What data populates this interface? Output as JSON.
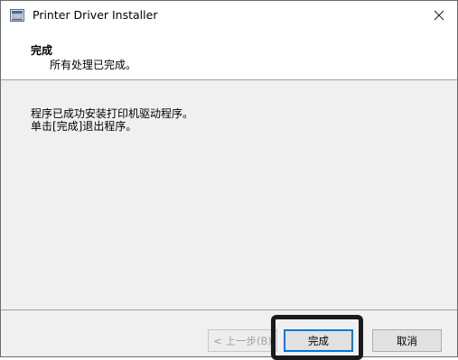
{
  "window": {
    "title": "Printer Driver Installer",
    "app_icon": "printer-installer-icon",
    "close_glyph": "✕"
  },
  "header": {
    "title": "完成",
    "subtitle": "所有处理已完成。"
  },
  "body": {
    "lines": [
      "程序已成功安装打印机驱动程序。",
      "单击[完成]退出程序。"
    ]
  },
  "footer": {
    "back_label": "< 上一步(B)",
    "finish_label": "完成",
    "cancel_label": "取消"
  },
  "colors": {
    "focus_border": "#0078d7",
    "panel_bg": "#f0f0f0",
    "button_bg": "#e1e1e1",
    "disabled_text": "#a0a0a0",
    "highlight_box": "#1a1a1a"
  }
}
